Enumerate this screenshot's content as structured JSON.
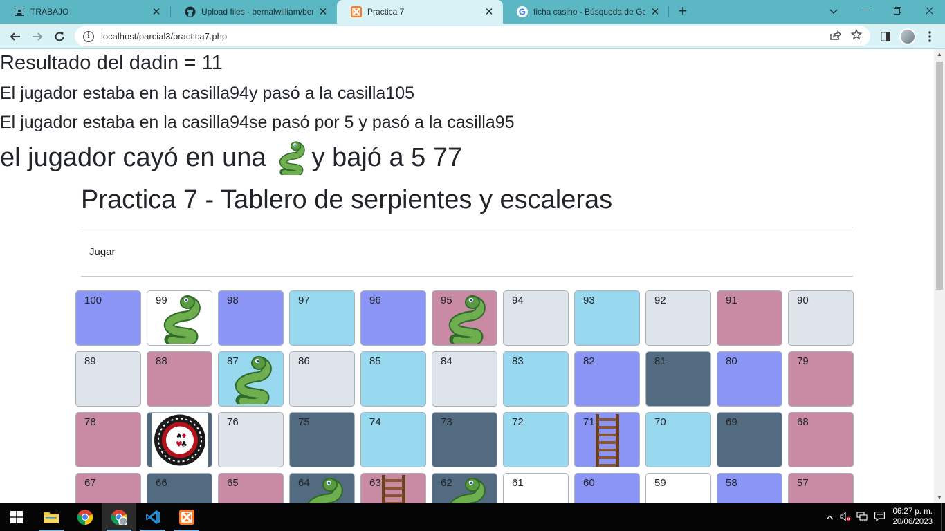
{
  "browser": {
    "tabs": [
      {
        "title": "TRABAJO",
        "icon": "profile-card-icon",
        "active": false
      },
      {
        "title": "Upload files · bernalwilliam/berna",
        "icon": "github-icon",
        "active": false
      },
      {
        "title": "Practica 7",
        "icon": "xampp-icon",
        "active": true
      },
      {
        "title": "ficha casino - Búsqueda de Goog",
        "icon": "google-icon",
        "active": false
      }
    ],
    "close_glyph": "✕",
    "new_tab_glyph": "+",
    "url": "localhost/parcial3/practica7.php"
  },
  "page": {
    "dice_result": "Resultado del dadin = 11",
    "move_message": "El jugador estaba en la casilla94y pasó a la casilla105",
    "overflow_message": "El jugador estaba en la casilla94se pasó por 5 y pasó a la casilla95",
    "snake_message_start": "el jugador cayó en una",
    "snake_message_end": "y bajó a 5 77",
    "heading": "Practica 7 - Tablero de serpientes y escaleras",
    "play_link": "Jugar"
  },
  "board": {
    "rows": [
      [
        {
          "n": "100",
          "color": "#8b95f5",
          "item": ""
        },
        {
          "n": "99",
          "color": "#ffffff",
          "item": "snake"
        },
        {
          "n": "98",
          "color": "#8b95f5",
          "item": ""
        },
        {
          "n": "97",
          "color": "#99d9f0",
          "item": ""
        },
        {
          "n": "96",
          "color": "#8b95f5",
          "item": ""
        },
        {
          "n": "95",
          "color": "#c98ba3",
          "item": "snake"
        },
        {
          "n": "94",
          "color": "#dee4ea",
          "item": ""
        },
        {
          "n": "93",
          "color": "#99d9f0",
          "item": ""
        },
        {
          "n": "92",
          "color": "#dee4ea",
          "item": ""
        },
        {
          "n": "91",
          "color": "#c98ba3",
          "item": ""
        },
        {
          "n": "90",
          "color": "#dee4ea",
          "item": ""
        }
      ],
      [
        {
          "n": "89",
          "color": "#dee4ea",
          "item": ""
        },
        {
          "n": "88",
          "color": "#c98ba3",
          "item": ""
        },
        {
          "n": "87",
          "color": "#99d9f0",
          "item": "snake"
        },
        {
          "n": "86",
          "color": "#dee4ea",
          "item": ""
        },
        {
          "n": "85",
          "color": "#99d9f0",
          "item": ""
        },
        {
          "n": "84",
          "color": "#dee4ea",
          "item": ""
        },
        {
          "n": "83",
          "color": "#99d9f0",
          "item": ""
        },
        {
          "n": "82",
          "color": "#8b95f5",
          "item": ""
        },
        {
          "n": "81",
          "color": "#536b80",
          "item": ""
        },
        {
          "n": "80",
          "color": "#8b95f5",
          "item": ""
        },
        {
          "n": "79",
          "color": "#c98ba3",
          "item": ""
        }
      ],
      [
        {
          "n": "78",
          "color": "#c98ba3",
          "item": ""
        },
        {
          "n": "77",
          "color": "#536b80",
          "item": "casino"
        },
        {
          "n": "76",
          "color": "#dee4ea",
          "item": ""
        },
        {
          "n": "75",
          "color": "#536b80",
          "item": ""
        },
        {
          "n": "74",
          "color": "#99d9f0",
          "item": ""
        },
        {
          "n": "73",
          "color": "#536b80",
          "item": ""
        },
        {
          "n": "72",
          "color": "#99d9f0",
          "item": ""
        },
        {
          "n": "71",
          "color": "#8b95f5",
          "item": "ladder"
        },
        {
          "n": "70",
          "color": "#99d9f0",
          "item": ""
        },
        {
          "n": "69",
          "color": "#536b80",
          "item": ""
        },
        {
          "n": "68",
          "color": "#c98ba3",
          "item": ""
        }
      ],
      [
        {
          "n": "67",
          "color": "#c98ba3",
          "item": ""
        },
        {
          "n": "66",
          "color": "#536b80",
          "item": ""
        },
        {
          "n": "65",
          "color": "#c98ba3",
          "item": ""
        },
        {
          "n": "64",
          "color": "#536b80",
          "item": "snake"
        },
        {
          "n": "63",
          "color": "#c98ba3",
          "item": "ladder"
        },
        {
          "n": "62",
          "color": "#536b80",
          "item": "snake"
        },
        {
          "n": "61",
          "color": "#ffffff",
          "item": ""
        },
        {
          "n": "60",
          "color": "#8b95f5",
          "item": ""
        },
        {
          "n": "59",
          "color": "#ffffff",
          "item": ""
        },
        {
          "n": "58",
          "color": "#8b95f5",
          "item": ""
        },
        {
          "n": "57",
          "color": "#c98ba3",
          "item": ""
        }
      ]
    ]
  },
  "taskbar": {
    "apps": [
      "file-explorer-icon",
      "chrome-icon",
      "chrome-profile-icon",
      "vscode-icon",
      "xampp-icon"
    ],
    "time": "06:27 p. m.",
    "date": "20/06/2023"
  },
  "colors": {
    "tabstrip": "#5bb7c3",
    "toolbar": "#d9f2f5",
    "text": "#212529"
  }
}
